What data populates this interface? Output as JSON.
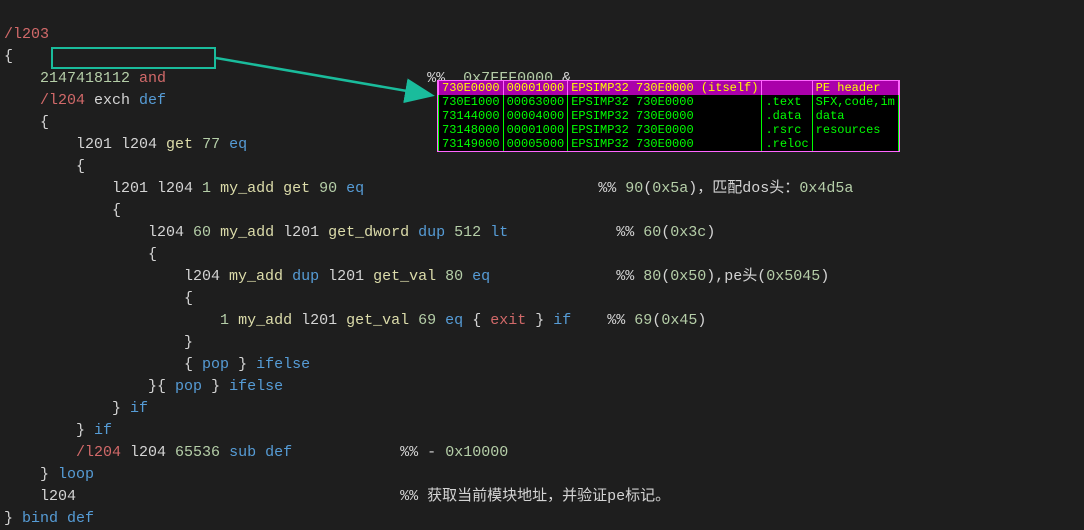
{
  "code": {
    "l1": {
      "name": "/l203"
    },
    "l2": {
      "brace": "{"
    },
    "l3": {
      "num": "2147418112",
      "kw": "and",
      "cmt_pfx": "%% ",
      "cmt_hex": "0x7FFF0000",
      "cmt_op": " &"
    },
    "l4": {
      "name": "/l204",
      "rest": " exch ",
      "def": "def"
    },
    "l5": {
      "brace": "{"
    },
    "l6": {
      "a": "l201 l204 ",
      "fn": "get",
      "sp": " ",
      "n1": "77",
      "sp2": " ",
      "eq": "eq"
    },
    "l7": {
      "brace": "{"
    },
    "l8": {
      "a": "l201 l204 ",
      "one": "1",
      "sp": " ",
      "fn": "my_add",
      "sp2": " ",
      "fn2": "get",
      "sp3": " ",
      "n": "90",
      "sp4": " ",
      "eq": "eq",
      "cmt_pfx": "%% ",
      "cmt_n": "90",
      "cmt_p1": "(",
      "cmt_hex": "0x5a",
      "cmt_p2": ")，匹配dos头：",
      "cmt_hex2": "0x4d5a"
    },
    "l9": {
      "brace": "{"
    },
    "l10": {
      "a": "l204 ",
      "n1": "60",
      "sp": " ",
      "fn": "my_add",
      "sp2": " l201 ",
      "fn2": "get_dword",
      "sp3": " ",
      "dup": "dup",
      "sp4": " ",
      "n2": "512",
      "sp5": " ",
      "lt": "lt",
      "cmt_pfx": "%% ",
      "cmt_n": "60",
      "cmt_p1": "(",
      "cmt_hex": "0x3c",
      "cmt_p2": ")"
    },
    "l11": {
      "brace": "{"
    },
    "l12": {
      "a": "l204 ",
      "fn": "my_add",
      "sp": " ",
      "dup": "dup",
      "sp2": " l201 ",
      "fn2": "get_val",
      "sp3": " ",
      "n": "80",
      "sp4": " ",
      "eq": "eq",
      "cmt_pfx": "%% ",
      "cmt_n": "80",
      "cmt_p1": "(",
      "cmt_hex": "0x50",
      "cmt_p2": "),pe头(",
      "cmt_hex2": "0x5045",
      "cmt_p3": ")"
    },
    "l13": {
      "brace": "{"
    },
    "l14": {
      "one": "1",
      "sp": " ",
      "fn": "my_add",
      "sp2": " l201 ",
      "fn2": "get_val",
      "sp3": " ",
      "n": "69",
      "sp4": " ",
      "eq": "eq",
      "sp5": " { ",
      "exit": "exit",
      "sp6": " } ",
      "if": "if",
      "cmt_pfx": "%% ",
      "cmt_n": "69",
      "cmt_p1": "(",
      "cmt_hex": "0x45",
      "cmt_p2": ")"
    },
    "l15": {
      "brace": "}"
    },
    "l16": {
      "a": "{ ",
      "pop": "pop",
      "b": " } ",
      "ifelse": "ifelse"
    },
    "l17": {
      "a": "}{ ",
      "pop": "pop",
      "b": " } ",
      "ifelse": "ifelse"
    },
    "l18": {
      "a": "} ",
      "if": "if"
    },
    "l19": {
      "a": "} ",
      "if": "if"
    },
    "l20": {
      "name": "/l204",
      "sp": " l204 ",
      "n": "65536",
      "sp2": " ",
      "sub": "sub",
      "sp3": " ",
      "def": "def",
      "cmt_pfx": "%% ",
      "cmt_op": "- ",
      "cmt_hex": "0x10000"
    },
    "l21": {
      "a": "} ",
      "loop": "loop"
    },
    "l22": {
      "a": "l204",
      "cmt": "%% 获取当前模块地址，并验证pe标记。"
    },
    "l23": {
      "a": "} ",
      "bind": "bind",
      "sp": " ",
      "def": "def"
    }
  },
  "pe_table": {
    "header": [
      "730E0000",
      "00001000",
      "EPSIMP32 730E0000 (itself)",
      "",
      "PE header"
    ],
    "rows": [
      [
        "730E1000",
        "00063000",
        "EPSIMP32 730E0000",
        ".text",
        "SFX,code,im"
      ],
      [
        "73144000",
        "00004000",
        "EPSIMP32 730E0000",
        ".data",
        "data"
      ],
      [
        "73148000",
        "00001000",
        "EPSIMP32 730E0000",
        ".rsrc",
        "resources"
      ],
      [
        "73149000",
        "00005000",
        "EPSIMP32 730E0000",
        ".reloc",
        ""
      ]
    ]
  }
}
